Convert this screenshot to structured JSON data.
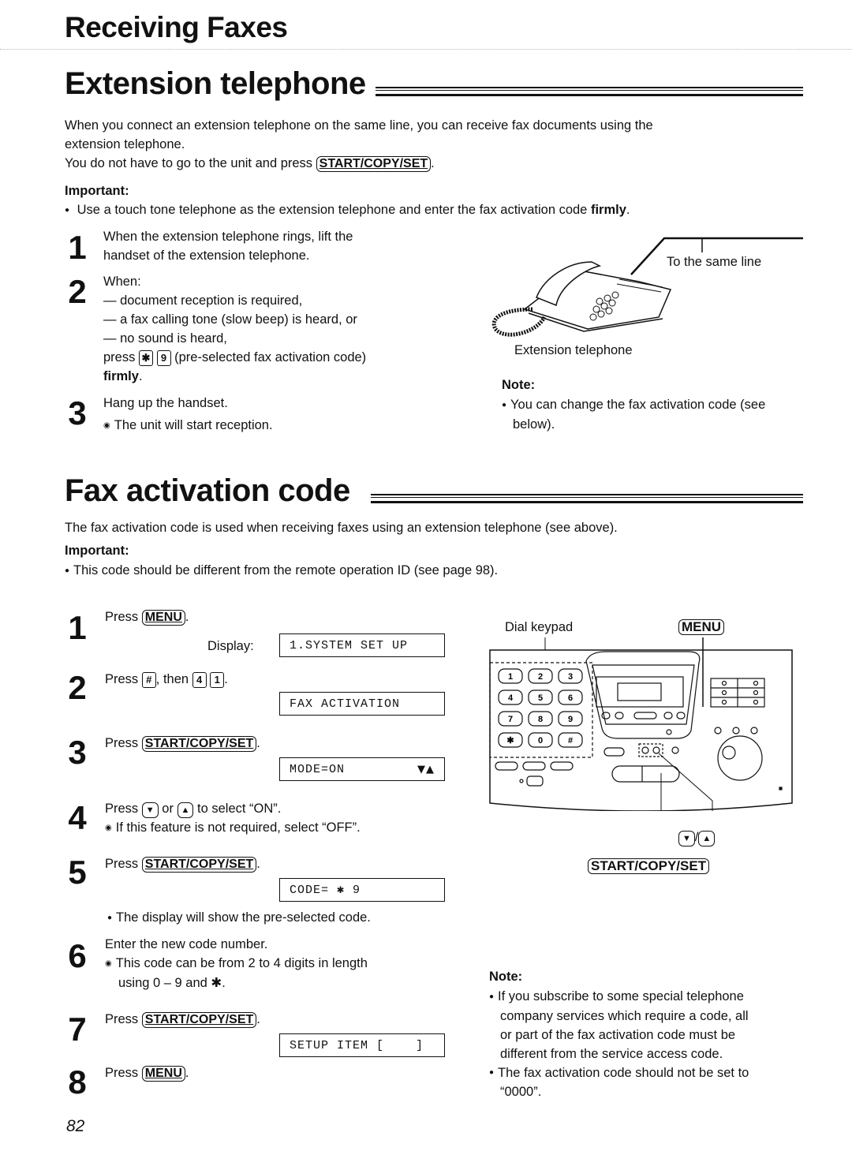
{
  "page": {
    "chapter_title": "Receiving Faxes",
    "page_number": "82"
  },
  "extension": {
    "heading": "Extension telephone",
    "intro_line1": "When you connect an extension telephone on the same line, you can receive fax documents using the",
    "intro_line2": "extension telephone.",
    "intro_line3_pre": "You do not have to go to the unit and press",
    "intro_line3_key": "START/COPY/SET",
    "intro_line3_post": ".",
    "important_label": "Important:",
    "important_pre": "Use a touch tone telephone as the extension telephone and enter the fax activation code",
    "important_bold": "firmly",
    "important_post": ".",
    "steps": [
      {
        "num": "1",
        "line1": "When the extension telephone rings, lift the",
        "line2": "handset of the extension telephone."
      },
      {
        "num": "2",
        "line1": "When:",
        "line2": "— document reception is required,",
        "line3": "— a fax calling tone (slow beep) is heard, or",
        "line4": "— no sound is heard,",
        "press_pre": "press",
        "key1": "✱",
        "key2": "9",
        "press_post": "(pre-selected fax activation code)",
        "firmly": "firmly",
        "period": "."
      },
      {
        "num": "3",
        "line1": "Hang up the handset.",
        "line2": "The unit will start reception."
      }
    ],
    "figure": {
      "line_label": "To the same line",
      "phone_label": "Extension telephone"
    },
    "note_label": "Note:",
    "note_line1": "You can change the fax activation code (see",
    "note_line2": "below)."
  },
  "fax_code": {
    "heading": "Fax activation code",
    "intro": "The fax activation code is used when receiving faxes using an extension telephone (see above).",
    "important_label": "Important:",
    "important_text": "This code should be different from the remote operation ID (see page 98).",
    "steps": [
      {
        "num": "1",
        "press": "Press",
        "key": "MENU",
        "post": ".",
        "display_label": "Display:",
        "lcd": "1.SYSTEM SET UP"
      },
      {
        "num": "2",
        "press": "Press",
        "key1": "#",
        "mid": ", then",
        "key2": "4",
        "key3": "1",
        "post": ".",
        "lcd": "FAX ACTIVATION"
      },
      {
        "num": "3",
        "press": "Press",
        "key": "START/COPY/SET",
        "post": ".",
        "lcd": "MODE=ON",
        "lcd_arrows": "▼▲"
      },
      {
        "num": "4",
        "press": "Press",
        "key1": "▼",
        "or": "or",
        "key2": "▲",
        "post": "to select “ON”.",
        "sub": "If this feature is not required, select “OFF”."
      },
      {
        "num": "5",
        "press": "Press",
        "key": "START/COPY/SET",
        "post": ".",
        "lcd": "CODE= ✱ 9",
        "sub": "The display will show the pre-selected code."
      },
      {
        "num": "6",
        "line1": "Enter the new code number.",
        "sub1": "This code can be from 2 to 4 digits in length",
        "sub2": "using 0 – 9 and ✱."
      },
      {
        "num": "7",
        "press": "Press",
        "key": "START/COPY/SET",
        "post": ".",
        "lcd": "SETUP ITEM [    ]"
      },
      {
        "num": "8",
        "press": "Press",
        "key": "MENU",
        "post": "."
      }
    ],
    "figure": {
      "dial_keypad_label": "Dial keypad",
      "menu_label": "MENU",
      "arrows_label_down": "▼",
      "arrows_sep": "/",
      "arrows_label_up": "▲",
      "start_label": "START/COPY/SET",
      "keys": [
        "1",
        "2",
        "3",
        "4",
        "5",
        "6",
        "7",
        "8",
        "9",
        "✱",
        "0",
        "#"
      ]
    },
    "note_label": "Note:",
    "notes": [
      [
        "If you subscribe to some special telephone",
        "company services which require a code, all",
        "or part of the fax activation code must be",
        "different from the service access code."
      ],
      [
        "The fax activation code should not be set to",
        "“0000”."
      ]
    ]
  }
}
